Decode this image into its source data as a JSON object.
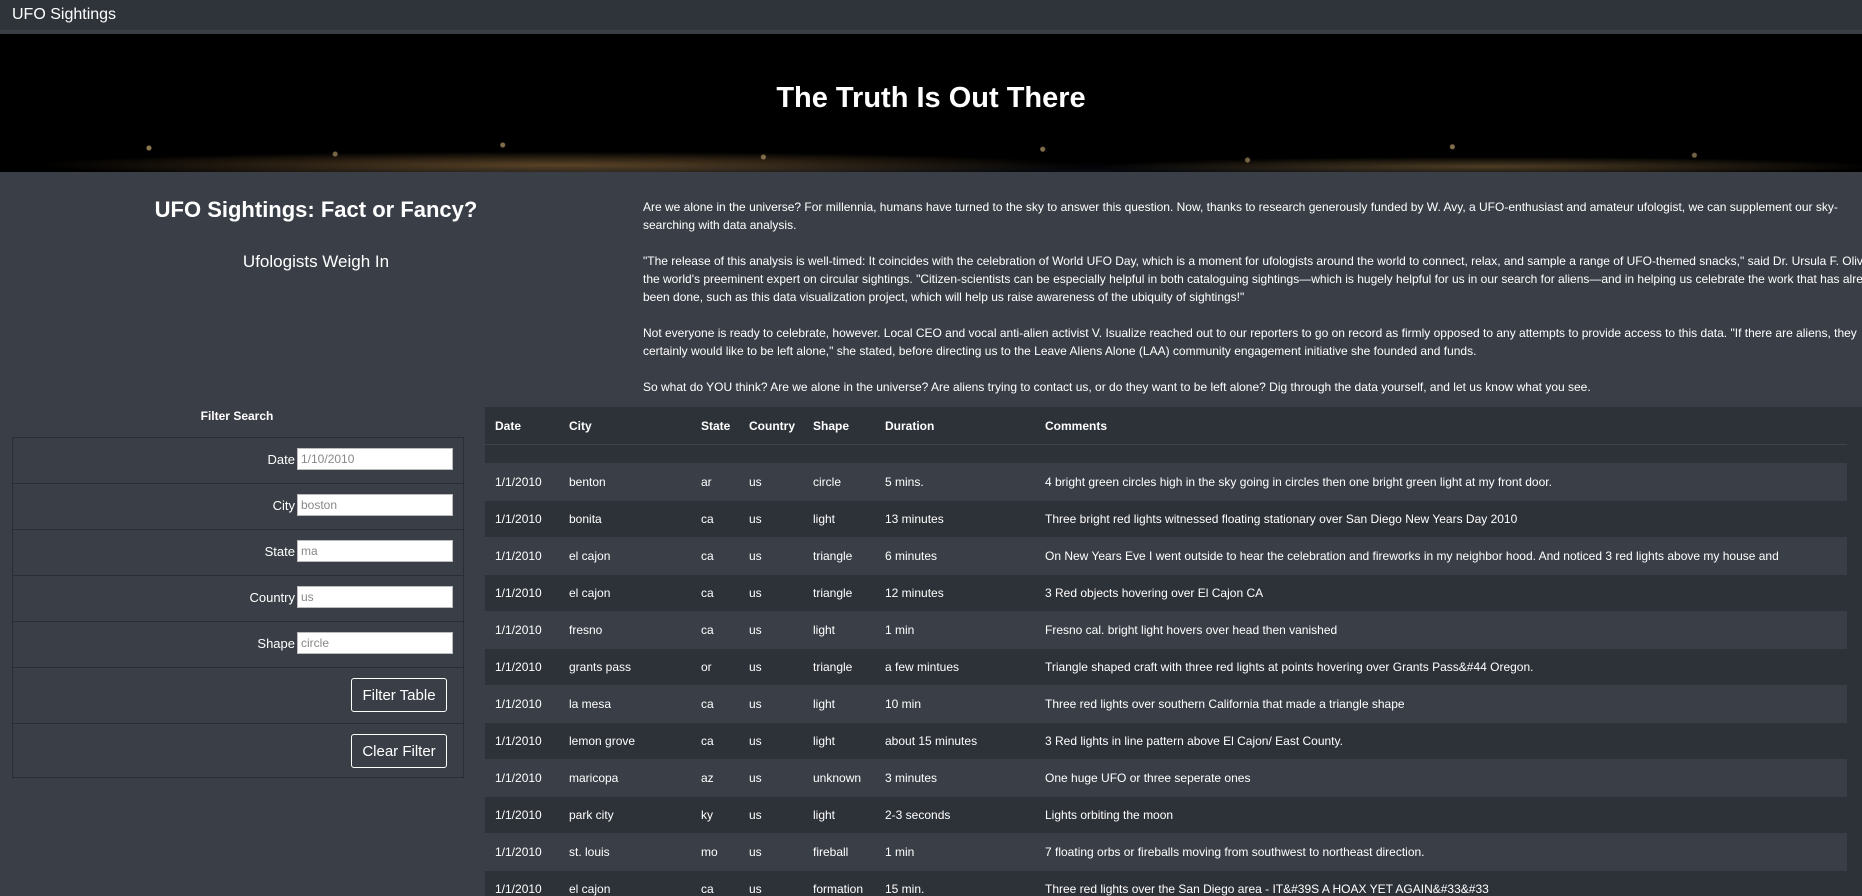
{
  "navbar": {
    "brand": "UFO Sightings"
  },
  "hero": {
    "title": "The Truth Is Out There"
  },
  "intro": {
    "title": "UFO Sightings: Fact or Fancy?",
    "subtitle": "Ufologists Weigh In"
  },
  "article": {
    "paragraphs": [
      "Are we alone in the universe? For millennia, humans have turned to the sky to answer this question. Now, thanks to research generously funded by W. Avy, a UFO-enthusiast and amateur ufologist, we can supplement our sky-searching with data analysis.",
      "\"The release of this analysis is well-timed: It coincides with the celebration of World UFO Day, which is a moment for ufologists around the world to connect, relax, and sample a range of UFO-themed snacks,\" said Dr. Ursula F. Olivia, the world's preeminent expert on circular sightings. \"Citizen-scientists can be especially helpful in both cataloguing sightings—which is hugely helpful for us in our search for aliens—and in helping us celebrate the work that has already been done, such as this data visualization project, which will help us raise awareness of the ubiquity of sightings!\"",
      "Not everyone is ready to celebrate, however. Local CEO and vocal anti-alien activist V. Isualize reached out to our reporters to go on record as firmly opposed to any attempts to provide access to this data. \"If there are aliens, they certainly would like to be left alone,\" she stated, before directing us to the Leave Aliens Alone (LAA) community engagement initiative she founded and funds.",
      "So what do YOU think? Are we alone in the universe? Are aliens trying to contact us, or do they want to be left alone? Dig through the data yourself, and let us know what you see."
    ]
  },
  "filters": {
    "title": "Filter Search",
    "date": {
      "label": "Date",
      "placeholder": "1/10/2010"
    },
    "city": {
      "label": "City",
      "placeholder": "boston"
    },
    "state": {
      "label": "State",
      "placeholder": "ma"
    },
    "country": {
      "label": "Country",
      "placeholder": "us"
    },
    "shape": {
      "label": "Shape",
      "placeholder": "circle"
    },
    "filter_button": "Filter Table",
    "clear_button": "Clear Filter"
  },
  "table": {
    "headers": [
      "Date",
      "City",
      "State",
      "Country",
      "Shape",
      "Duration",
      "Comments"
    ],
    "rows": [
      [
        "1/1/2010",
        "benton",
        "ar",
        "us",
        "circle",
        "5 mins.",
        "4 bright green circles high in the sky going in circles then one bright green light at my front door."
      ],
      [
        "1/1/2010",
        "bonita",
        "ca",
        "us",
        "light",
        "13 minutes",
        "Three bright red lights witnessed floating stationary over San Diego New Years Day 2010"
      ],
      [
        "1/1/2010",
        "el cajon",
        "ca",
        "us",
        "triangle",
        "6 minutes",
        "On New Years Eve I went outside to hear the celebration and fireworks in my neighbor hood. And noticed 3 red lights above my house and"
      ],
      [
        "1/1/2010",
        "el cajon",
        "ca",
        "us",
        "triangle",
        "12 minutes",
        "3 Red objects hovering over El Cajon CA"
      ],
      [
        "1/1/2010",
        "fresno",
        "ca",
        "us",
        "light",
        "1 min",
        "Fresno cal. bright light hovers over head then vanished"
      ],
      [
        "1/1/2010",
        "grants pass",
        "or",
        "us",
        "triangle",
        "a few mintues",
        "Triangle shaped craft with three red lights at points hovering over Grants Pass&#44 Oregon."
      ],
      [
        "1/1/2010",
        "la mesa",
        "ca",
        "us",
        "light",
        "10 min",
        "Three red lights over southern California that made a triangle shape"
      ],
      [
        "1/1/2010",
        "lemon grove",
        "ca",
        "us",
        "light",
        "about 15 minutes",
        "3 Red lights in line pattern above El Cajon/ East County."
      ],
      [
        "1/1/2010",
        "maricopa",
        "az",
        "us",
        "unknown",
        "3 minutes",
        "One huge UFO or three seperate ones"
      ],
      [
        "1/1/2010",
        "park city",
        "ky",
        "us",
        "light",
        "2-3 seconds",
        "Lights orbiting the moon"
      ],
      [
        "1/1/2010",
        "st. louis",
        "mo",
        "us",
        "fireball",
        "1 min",
        "7 floating orbs or fireballs moving from southwest to northeast direction."
      ],
      [
        "1/1/2010",
        "el cajon",
        "ca",
        "us",
        "formation",
        "15 min.",
        "Three red lights over the San Diego area - IT&#39S A HOAX YET AGAIN&#33&#33"
      ]
    ]
  }
}
